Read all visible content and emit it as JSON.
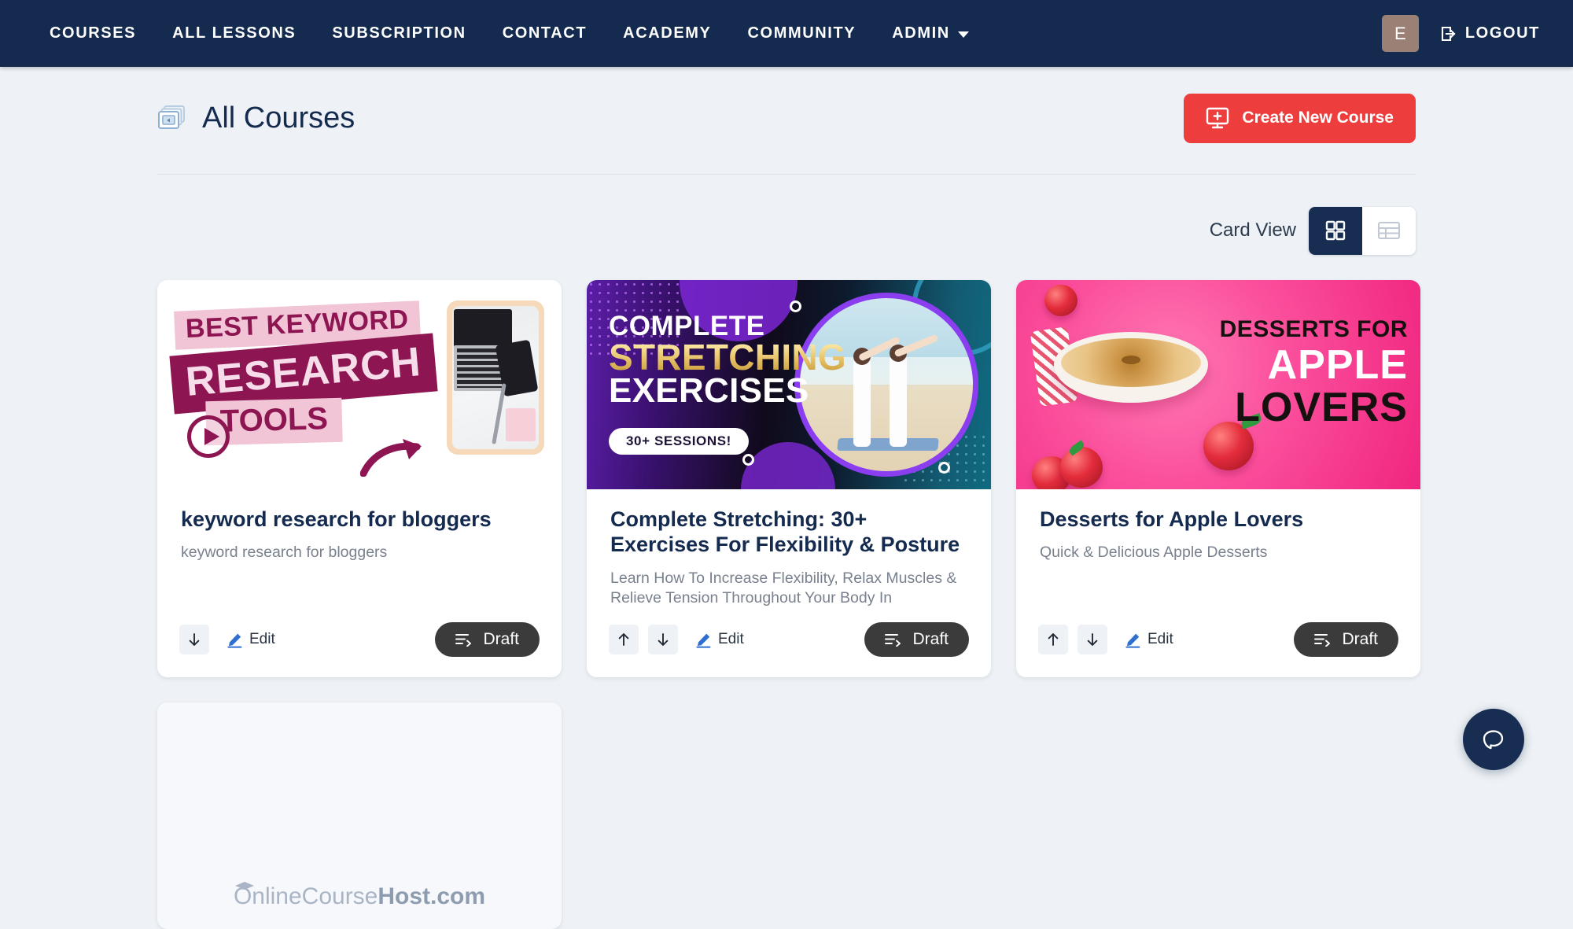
{
  "navbar": {
    "links": [
      {
        "label": "COURSES"
      },
      {
        "label": "ALL LESSONS"
      },
      {
        "label": "SUBSCRIPTION"
      },
      {
        "label": "CONTACT"
      },
      {
        "label": "ACADEMY"
      },
      {
        "label": "COMMUNITY"
      },
      {
        "label": "ADMIN"
      }
    ],
    "avatar_initial": "E",
    "logout_label": "LOGOUT",
    "background_color": "#142a4e"
  },
  "header": {
    "title": "All Courses",
    "create_button_label": "Create New Course",
    "create_button_color": "#ed3d3d"
  },
  "view_toggle": {
    "label": "Card View",
    "active": "card",
    "options": [
      {
        "id": "card",
        "icon": "grid-icon"
      },
      {
        "id": "list",
        "icon": "table-icon"
      }
    ],
    "active_color": "#172e52"
  },
  "cards": [
    {
      "title": "keyword research for bloggers",
      "description": "keyword research for bloggers",
      "status_label": "Draft",
      "edit_label": "Edit",
      "has_move_up": false,
      "has_move_down": true,
      "thumbnail": {
        "kind": "keyword-research",
        "line1": "BEST KEYWORD",
        "line2": "RESEARCH",
        "line3": "TOOLS"
      }
    },
    {
      "title": "Complete Stretching: 30+ Exercises For Flexibility & Posture",
      "description": "Learn How To Increase Flexibility, Relax Muscles & Relieve Tension Throughout Your Body In",
      "status_label": "Draft",
      "edit_label": "Edit",
      "has_move_up": true,
      "has_move_down": true,
      "thumbnail": {
        "kind": "stretching",
        "line1": "COMPLETE",
        "line2": "STRETCHING",
        "line3": "EXERCISES",
        "badge": "30+ SESSIONS!"
      }
    },
    {
      "title": "Desserts for Apple Lovers",
      "description": "Quick & Delicious Apple Desserts",
      "status_label": "Draft",
      "edit_label": "Edit",
      "has_move_up": true,
      "has_move_down": true,
      "thumbnail": {
        "kind": "apple-desserts",
        "line1": "DESSERTS FOR",
        "line2": "APPLE",
        "line3": "LOVERS"
      }
    },
    {
      "title": "",
      "description": "",
      "status_label": "",
      "edit_label": "",
      "has_move_up": false,
      "has_move_down": false,
      "thumbnail": {
        "kind": "placeholder",
        "logo_prefix": "OnlineCourse",
        "logo_suffix": "Host.com"
      }
    }
  ],
  "chat_widget": {
    "icon": "chat-bubble-icon",
    "color": "#172e52"
  }
}
